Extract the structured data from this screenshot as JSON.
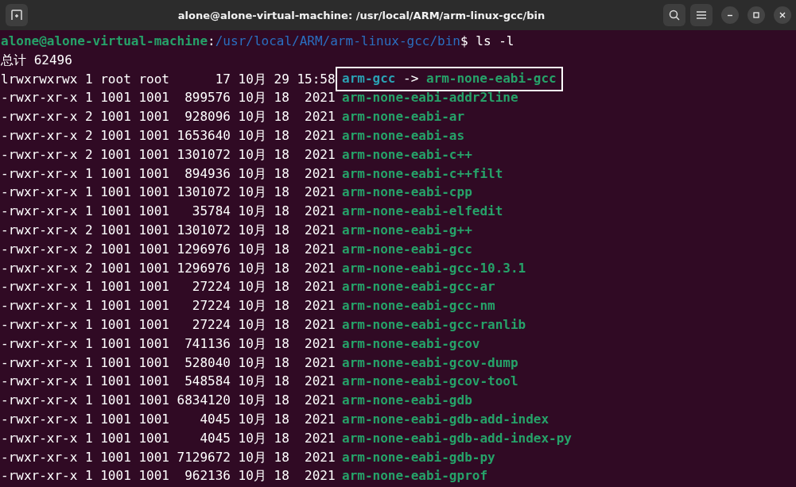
{
  "window": {
    "title": "alone@alone-virtual-machine: /usr/local/ARM/arm-linux-gcc/bin"
  },
  "prompt": {
    "user_host": "alone@alone-virtual-machine",
    "separator": ":",
    "path": "/usr/local/ARM/arm-linux-gcc/bin",
    "command": "$ ls -l"
  },
  "total": "总计 62496",
  "rows": [
    {
      "kind": "symlink",
      "meta": "lrwxrwxrwx 1 root root      17 10月 29 15:58",
      "name": "arm-gcc",
      "arrow": "->",
      "target": "arm-none-eabi-gcc",
      "highlighted": true
    },
    {
      "kind": "file",
      "meta": "-rwxr-xr-x 1 1001 1001  899576 10月 18  2021",
      "name": "arm-none-eabi-addr2line"
    },
    {
      "kind": "file",
      "meta": "-rwxr-xr-x 2 1001 1001  928096 10月 18  2021",
      "name": "arm-none-eabi-ar"
    },
    {
      "kind": "file",
      "meta": "-rwxr-xr-x 2 1001 1001 1653640 10月 18  2021",
      "name": "arm-none-eabi-as"
    },
    {
      "kind": "file",
      "meta": "-rwxr-xr-x 2 1001 1001 1301072 10月 18  2021",
      "name": "arm-none-eabi-c++"
    },
    {
      "kind": "file",
      "meta": "-rwxr-xr-x 1 1001 1001  894936 10月 18  2021",
      "name": "arm-none-eabi-c++filt"
    },
    {
      "kind": "file",
      "meta": "-rwxr-xr-x 1 1001 1001 1301072 10月 18  2021",
      "name": "arm-none-eabi-cpp"
    },
    {
      "kind": "file",
      "meta": "-rwxr-xr-x 1 1001 1001   35784 10月 18  2021",
      "name": "arm-none-eabi-elfedit"
    },
    {
      "kind": "file",
      "meta": "-rwxr-xr-x 2 1001 1001 1301072 10月 18  2021",
      "name": "arm-none-eabi-g++"
    },
    {
      "kind": "file",
      "meta": "-rwxr-xr-x 2 1001 1001 1296976 10月 18  2021",
      "name": "arm-none-eabi-gcc"
    },
    {
      "kind": "file",
      "meta": "-rwxr-xr-x 2 1001 1001 1296976 10月 18  2021",
      "name": "arm-none-eabi-gcc-10.3.1"
    },
    {
      "kind": "file",
      "meta": "-rwxr-xr-x 1 1001 1001   27224 10月 18  2021",
      "name": "arm-none-eabi-gcc-ar"
    },
    {
      "kind": "file",
      "meta": "-rwxr-xr-x 1 1001 1001   27224 10月 18  2021",
      "name": "arm-none-eabi-gcc-nm"
    },
    {
      "kind": "file",
      "meta": "-rwxr-xr-x 1 1001 1001   27224 10月 18  2021",
      "name": "arm-none-eabi-gcc-ranlib"
    },
    {
      "kind": "file",
      "meta": "-rwxr-xr-x 1 1001 1001  741136 10月 18  2021",
      "name": "arm-none-eabi-gcov"
    },
    {
      "kind": "file",
      "meta": "-rwxr-xr-x 1 1001 1001  528040 10月 18  2021",
      "name": "arm-none-eabi-gcov-dump"
    },
    {
      "kind": "file",
      "meta": "-rwxr-xr-x 1 1001 1001  548584 10月 18  2021",
      "name": "arm-none-eabi-gcov-tool"
    },
    {
      "kind": "file",
      "meta": "-rwxr-xr-x 1 1001 1001 6834120 10月 18  2021",
      "name": "arm-none-eabi-gdb"
    },
    {
      "kind": "file",
      "meta": "-rwxr-xr-x 1 1001 1001    4045 10月 18  2021",
      "name": "arm-none-eabi-gdb-add-index"
    },
    {
      "kind": "file",
      "meta": "-rwxr-xr-x 1 1001 1001    4045 10月 18  2021",
      "name": "arm-none-eabi-gdb-add-index-py"
    },
    {
      "kind": "file",
      "meta": "-rwxr-xr-x 1 1001 1001 7129672 10月 18  2021",
      "name": "arm-none-eabi-gdb-py"
    },
    {
      "kind": "file",
      "meta": "-rwxr-xr-x 1 1001 1001  962136 10月 18  2021",
      "name": "arm-none-eabi-gprof"
    }
  ]
}
